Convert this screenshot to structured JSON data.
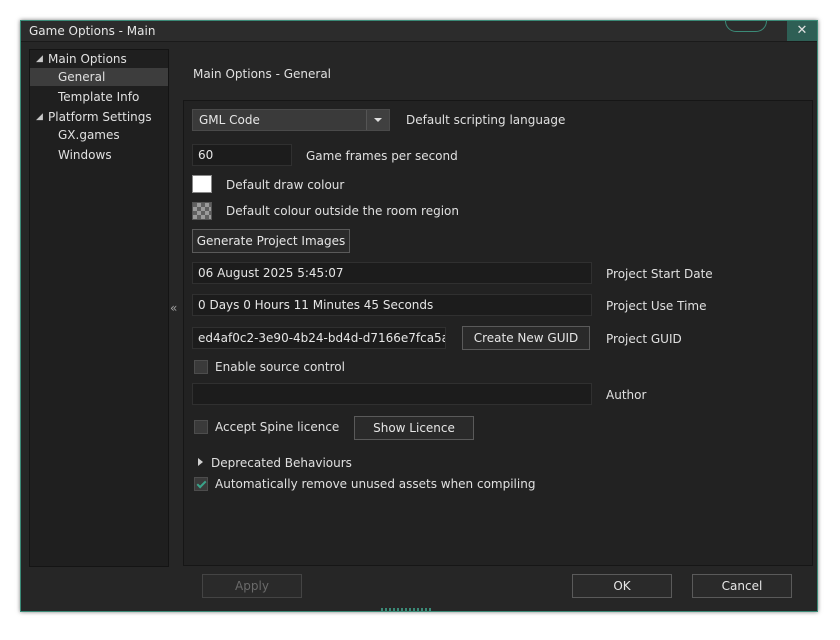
{
  "window": {
    "title": "Game Options - Main",
    "close_glyph": "✕"
  },
  "tree": {
    "items": [
      {
        "label": "Main Options",
        "expanded": true
      },
      {
        "label": "General",
        "selected": true
      },
      {
        "label": "Template Info"
      },
      {
        "label": "Platform Settings",
        "expanded": true
      },
      {
        "label": "GX.games"
      },
      {
        "label": "Windows"
      }
    ],
    "expanded_glyph": "◢",
    "collapse_handle": "«"
  },
  "section_title": "Main Options - General",
  "general": {
    "scripting_language": {
      "value": "GML Code",
      "label": "Default scripting language"
    },
    "fps": {
      "value": "60",
      "label": "Game frames per second"
    },
    "draw_colour": {
      "label": "Default draw colour",
      "color": "#ffffff"
    },
    "outside_colour": {
      "label": "Default colour outside the room region"
    },
    "generate_images_button": "Generate Project Images",
    "start_date": {
      "value": "06 August 2025 5:45:07",
      "label": "Project Start Date"
    },
    "use_time": {
      "value": "0 Days 0 Hours 11 Minutes 45 Seconds",
      "label": "Project Use Time"
    },
    "guid": {
      "value": "ed4af0c2-3e90-4b24-bd4d-d7166e7fca5a",
      "label": "Project GUID",
      "button": "Create New GUID"
    },
    "source_control": {
      "label": "Enable source control",
      "checked": false
    },
    "author": {
      "value": "",
      "label": "Author"
    },
    "spine": {
      "label": "Accept Spine licence",
      "checked": false,
      "button": "Show Licence"
    },
    "deprecated": {
      "label": "Deprecated Behaviours"
    },
    "remove_unused": {
      "label": "Automatically remove unused assets when compiling",
      "checked": true
    }
  },
  "footer": {
    "apply": "Apply",
    "ok": "OK",
    "cancel": "Cancel"
  },
  "colors": {
    "accent": "#3b8a77",
    "background": "#262626",
    "panel": "#222222"
  }
}
